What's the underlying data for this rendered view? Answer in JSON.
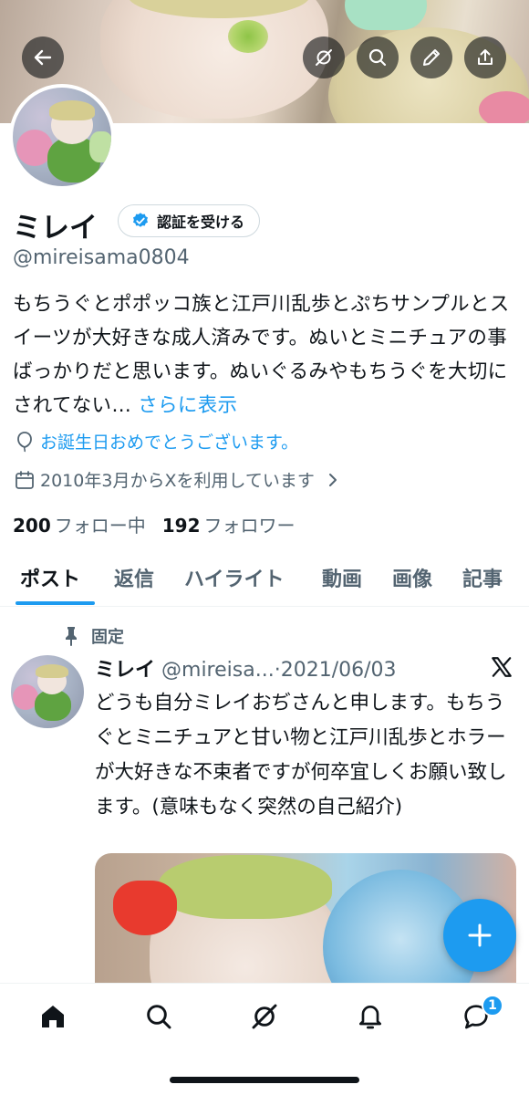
{
  "profile": {
    "name": "ミレイ",
    "verify_label": "認証を受ける",
    "handle": "@mireisama0804",
    "bio": "もちうぐとポポッコ族と江戸川乱歩とぷちサンプルとスイーツが大好きな成人済みです。ぬいとミニチュアの事ばっかりだと思います。ぬいぐるみやもちうぐを大切にされてない…",
    "bio_more": "さらに表示",
    "birthday_text": "お誕生日おめでとうございます。",
    "joined_text": "2010年3月からXを利用しています",
    "following_count": "200",
    "following_label": "フォロー中",
    "followers_count": "192",
    "followers_label": "フォロワー"
  },
  "tabs": [
    {
      "label": "ポスト",
      "active": true
    },
    {
      "label": "返信"
    },
    {
      "label": "ハイライト"
    },
    {
      "label": "動画"
    },
    {
      "label": "画像"
    },
    {
      "label": "記事"
    }
  ],
  "pinned_post": {
    "pinned_label": "固定",
    "author_name": "ミレイ",
    "author_handle": "@mireisa...",
    "date": "2021/06/03",
    "text": "どうも自分ミレイおぢさんと申します。もちうぐとミニチュアと甘い物と江戸川乱歩とホラーが大好きな不束者ですが何卒宜しくお願い致します。(意味もなく突然の自己紹介)"
  },
  "nav": {
    "notifications_badge": "1",
    "items": [
      "home-icon",
      "search-icon",
      "grok-icon",
      "bell-icon",
      "messages-icon"
    ]
  },
  "colors": {
    "accent": "#1d9bf0",
    "text_primary": "#0f1419",
    "text_secondary": "#536471"
  }
}
